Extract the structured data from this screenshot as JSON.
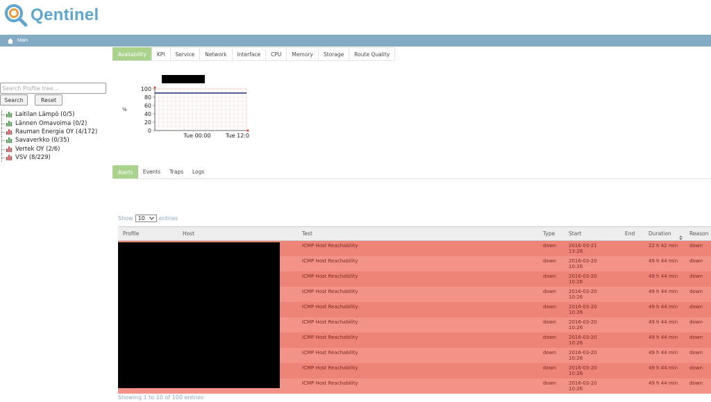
{
  "app": {
    "name": "Qentinel"
  },
  "menubar": {
    "main_label": "Main"
  },
  "sidebar": {
    "search_placeholder": "Search Profile tree...",
    "search_button": "Search",
    "reset_button": "Reset",
    "tree": [
      {
        "label": "Laitilan Lämpö (0/5)",
        "status": "green"
      },
      {
        "label": "Lännen Omavoima (0/2)",
        "status": "green"
      },
      {
        "label": "Rauman Energia OY (4/172)",
        "status": "red"
      },
      {
        "label": "Savaverkko (0/35)",
        "status": "green"
      },
      {
        "label": "Vertek OY (2/6)",
        "status": "red"
      },
      {
        "label": "VSV (8/229)",
        "status": "red"
      }
    ]
  },
  "top_tabs": [
    "Availability",
    "KPI",
    "Service",
    "Network",
    "Interface",
    "CPU",
    "Memory",
    "Storage",
    "Route Quality"
  ],
  "chart": {
    "y_ticks": [
      "100",
      "80",
      "60",
      "40",
      "20",
      "0"
    ],
    "x_ticks": [
      "Tue 00:00",
      "Tue 12:0"
    ],
    "side_label": "%"
  },
  "chart_data": {
    "type": "line",
    "ylim": [
      0,
      100
    ],
    "x": [
      "",
      "Tue 00:00",
      "Tue 12:0"
    ],
    "series": [
      {
        "values": [
          90,
          90,
          90
        ]
      }
    ],
    "grid": true
  },
  "bottom_tabs": [
    "Alerts",
    "Events",
    "Traps",
    "Logs"
  ],
  "table": {
    "show_label": "Show",
    "show_value": "10",
    "entries_label": "entries",
    "columns": [
      "Profile",
      "Host",
      "Test",
      "Type",
      "Start",
      "End",
      "Duration",
      "Reason"
    ],
    "rows": [
      {
        "test": "ICMP Host Reachability",
        "type": "down",
        "start_date": "2016-03-21",
        "start_time": "13:28",
        "end": "",
        "duration": "22 h 42 min",
        "reason": "down"
      },
      {
        "test": "ICMP Host Reachability",
        "type": "down",
        "start_date": "2016-03-20",
        "start_time": "10:26",
        "end": "",
        "duration": "49 h 44 min",
        "reason": "down"
      },
      {
        "test": "ICMP Host Reachability",
        "type": "down",
        "start_date": "2016-03-20",
        "start_time": "10:26",
        "end": "",
        "duration": "49 h 44 min",
        "reason": "down"
      },
      {
        "test": "ICMP Host Reachability",
        "type": "down",
        "start_date": "2016-03-20",
        "start_time": "10:26",
        "end": "",
        "duration": "49 h 44 min",
        "reason": "down"
      },
      {
        "test": "ICMP Host Reachability",
        "type": "down",
        "start_date": "2016-03-20",
        "start_time": "10:26",
        "end": "",
        "duration": "49 h 44 min",
        "reason": "down"
      },
      {
        "test": "ICMP Host Reachability",
        "type": "down",
        "start_date": "2016-03-20",
        "start_time": "10:26",
        "end": "",
        "duration": "49 h 44 min",
        "reason": "down"
      },
      {
        "test": "ICMP Host Reachability",
        "type": "down",
        "start_date": "2016-03-20",
        "start_time": "10:26",
        "end": "",
        "duration": "49 h 44 min",
        "reason": "down"
      },
      {
        "test": "ICMP Host Reachability",
        "type": "down",
        "start_date": "2016-03-20",
        "start_time": "10:26",
        "end": "",
        "duration": "49 h 44 min",
        "reason": "down"
      },
      {
        "test": "ICMP Host Reachability",
        "type": "down",
        "start_date": "2016-03-20",
        "start_time": "10:26",
        "end": "",
        "duration": "49 h 44 min",
        "reason": "down"
      },
      {
        "test": "ICMP Host Reachability",
        "type": "down",
        "start_date": "2016-03-20",
        "start_time": "10:26",
        "end": "",
        "duration": "49 h 44 min",
        "reason": "down"
      }
    ],
    "info": "Showing 1 to 10 of 100 entries"
  },
  "colors": {
    "accent_green": "#a9d28c",
    "menubar": "#84abc4",
    "row_red": "#ee8378",
    "logo_blue": "#5fa6cf",
    "logo_orange": "#f09a3a"
  }
}
